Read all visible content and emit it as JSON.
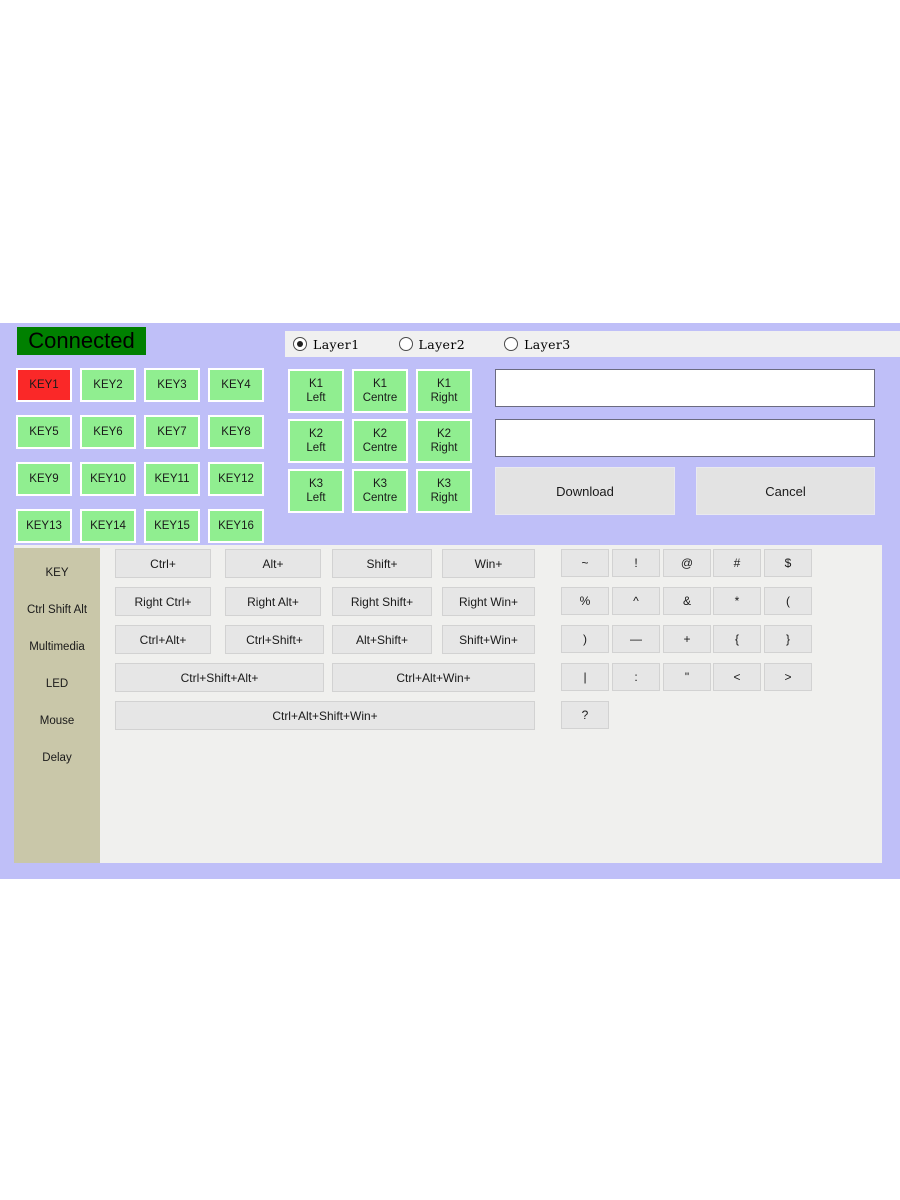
{
  "colors": {
    "panel_purple": "#bfbff8",
    "status_green": "#008000",
    "key_green": "#90ee90",
    "key_active_red": "#fa2828",
    "sidebar_tan": "#c9c7a9",
    "content_gray": "#f0f0ee",
    "button_gray": "#e6e6e6"
  },
  "status": {
    "label": "Connected"
  },
  "layer_bar": {
    "options": [
      {
        "label": "Layer1",
        "selected": true
      },
      {
        "label": "Layer2",
        "selected": false
      },
      {
        "label": "Layer3",
        "selected": false
      }
    ]
  },
  "key_grid": {
    "keys": [
      {
        "label": "KEY1",
        "active": true
      },
      {
        "label": "KEY2",
        "active": false
      },
      {
        "label": "KEY3",
        "active": false
      },
      {
        "label": "KEY4",
        "active": false
      },
      {
        "label": "KEY5",
        "active": false
      },
      {
        "label": "KEY6",
        "active": false
      },
      {
        "label": "KEY7",
        "active": false
      },
      {
        "label": "KEY8",
        "active": false
      },
      {
        "label": "KEY9",
        "active": false
      },
      {
        "label": "KEY10",
        "active": false
      },
      {
        "label": "KEY11",
        "active": false
      },
      {
        "label": "KEY12",
        "active": false
      },
      {
        "label": "KEY13",
        "active": false
      },
      {
        "label": "KEY14",
        "active": false
      },
      {
        "label": "KEY15",
        "active": false
      },
      {
        "label": "KEY16",
        "active": false
      }
    ]
  },
  "knob_grid": {
    "knobs": [
      {
        "line1": "K1",
        "line2": "Left"
      },
      {
        "line1": "K1",
        "line2": "Centre"
      },
      {
        "line1": "K1",
        "line2": "Right"
      },
      {
        "line1": "K2",
        "line2": "Left"
      },
      {
        "line1": "K2",
        "line2": "Centre"
      },
      {
        "line1": "K2",
        "line2": "Right"
      },
      {
        "line1": "K3",
        "line2": "Left"
      },
      {
        "line1": "K3",
        "line2": "Centre"
      },
      {
        "line1": "K3",
        "line2": "Right"
      }
    ]
  },
  "macro_inputs": [
    {
      "value": "",
      "placeholder": ""
    },
    {
      "value": "",
      "placeholder": ""
    }
  ],
  "actions": {
    "download_label": "Download",
    "cancel_label": "Cancel"
  },
  "sidebar": {
    "items": [
      {
        "label": "KEY",
        "selected": false
      },
      {
        "label": "Ctrl Shift Alt",
        "selected": true
      },
      {
        "label": "Multimedia",
        "selected": false
      },
      {
        "label": "LED",
        "selected": false
      },
      {
        "label": "Mouse",
        "selected": false
      },
      {
        "label": "Delay",
        "selected": false
      }
    ]
  },
  "modifiers": {
    "rows": [
      [
        {
          "label": "Ctrl+"
        },
        {
          "label": "Alt+"
        },
        {
          "label": "Shift+"
        },
        {
          "label": "Win+"
        }
      ],
      [
        {
          "label": "Right  Ctrl+"
        },
        {
          "label": "Right Alt+"
        },
        {
          "label": "Right Shift+"
        },
        {
          "label": "Right Win+"
        }
      ],
      [
        {
          "label": "Ctrl+Alt+"
        },
        {
          "label": "Ctrl+Shift+"
        },
        {
          "label": "Alt+Shift+"
        },
        {
          "label": "Shift+Win+"
        }
      ],
      [
        {
          "label": "Ctrl+Shift+Alt+"
        },
        {
          "label": "Ctrl+Alt+Win+"
        }
      ],
      [
        {
          "label": "Ctrl+Alt+Shift+Win+"
        }
      ]
    ]
  },
  "symbols": {
    "rows": [
      [
        "~",
        "!",
        "@",
        "#",
        "$"
      ],
      [
        "%",
        "^",
        "&",
        "*",
        "("
      ],
      [
        ")",
        "—",
        "+",
        "{",
        "}"
      ],
      [
        "|",
        ":",
        "\"",
        "<",
        ">"
      ],
      [
        "?"
      ]
    ]
  }
}
